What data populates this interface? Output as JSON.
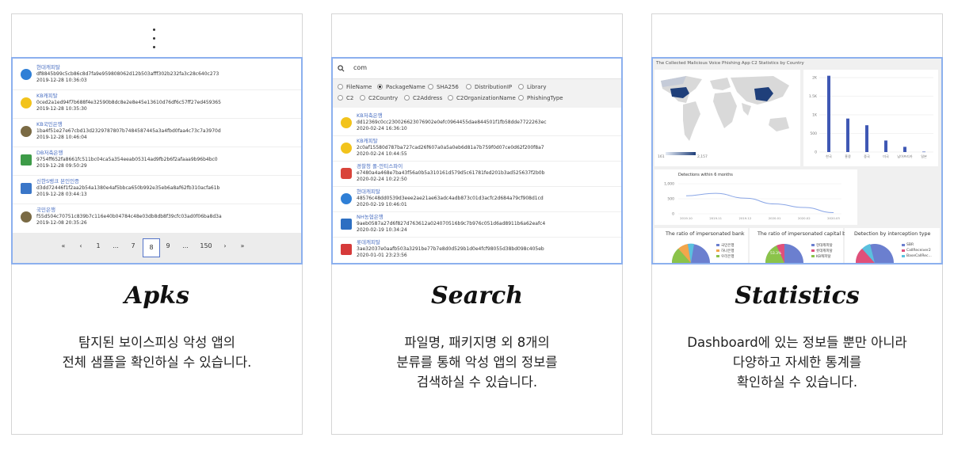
{
  "apks": {
    "title": "Apks",
    "desc": [
      "탐지된 보이스피싱 악성 앱의",
      "전체 샘플을 확인하실 수 있습니다."
    ],
    "rows": [
      {
        "name": "현대캐피탈",
        "hash": "df8845b99c5cb86c8d7fa9e959808062d12b503afff302b232fa3c28c640c273",
        "date": "2019-12-28 10:36:03",
        "icon_color": "#2f7fd6",
        "icon": "circle-logo-icon"
      },
      {
        "name": "KB캐피탈",
        "hash": "0ced2a1ed94f7b688f4e32590b8dc8e2e8e45e13610d76df6c57ff27ed459365",
        "date": "2019-12-28 10:35:30",
        "icon_color": "#f2c31c",
        "icon": "kb-logo-icon"
      },
      {
        "name": "KB국민은행",
        "hash": "1ba4f51e27e67cbd13d2329787807b7484587445a3a4fbd0faa4c73c7a3970d",
        "date": "2019-12-28 10:46:04",
        "icon_color": "#7a6a44",
        "icon": "kb-bank-logo-icon"
      },
      {
        "name": "DB저축은행",
        "hash": "9754ff652fa8661fc511bc04ca5a354eeab05314ad9fb2b6f2afaaa9b96b4bc0",
        "date": "2019-12-28 09:50:29",
        "icon_color": "#3d9b48",
        "icon": "db-logo-icon"
      },
      {
        "name": "신한S뱅크 본인인증",
        "hash": "d3dd72446f1f2aa2b54a1380e4af5bbca650b992e35eb6a8af62fb310acfa61b",
        "date": "2019-12-28 03:44:13",
        "icon_color": "#3a76c8",
        "icon": "shinhan-logo-icon"
      },
      {
        "name": "국민은행",
        "hash": "f55d504c70751c839b7c116e40b04784c48e03db8db8f39cfc03ad0f06ba8d3a",
        "date": "2019-12-08 20:35:26",
        "icon_color": "#7a6a44",
        "icon": "kb-bank-logo-icon"
      }
    ],
    "pager": [
      "«",
      "‹",
      "1",
      "...",
      "7",
      "8",
      "9",
      "...",
      "150",
      "›",
      "»"
    ],
    "pager_active": "8"
  },
  "search": {
    "title": "Search",
    "desc": [
      "파일명, 패키지명 외 8개의",
      "분류를 통해 악성 앱의 정보를",
      "검색하실 수 있습니다."
    ],
    "query": "com",
    "filters_row1": [
      "FileName",
      "PackageName",
      "SHA256",
      "DistributionIP",
      "Library"
    ],
    "filters_row2": [
      "C2",
      "C2Country",
      "C2Address",
      "C2OrganizationName",
      "PhishingType"
    ],
    "selected_filter": "PackageName",
    "rows": [
      {
        "name": "KB저축은행",
        "hash": "dd12369c0cc230026623076902e0efc0964455dae844501f1fb58dde7722263ec",
        "date": "2020-02-24 16:36:10",
        "icon_color": "#f2c31c"
      },
      {
        "name": "KB캐피탈",
        "hash": "2c0af15580d787ba727cad26f607a0a5a0eb6d81a7b759f0d07ce0d62f200f8a7",
        "date": "2020-02-24 10:44:55",
        "icon_color": "#f2c31c"
      },
      {
        "name": "경찰청 폴-안티스파이",
        "hash": "e7480a4a468e7ba43f56a0b5a310161d579d5c61781fed201b3ad525637f2b0b",
        "date": "2020-02-24 10:22:50",
        "icon_color": "#d9443a"
      },
      {
        "name": "현대캐피탈",
        "hash": "48576c48dd0539d3eee2ae21ae63adc4adb873c01d3acfc2d684a79cf908d1cd",
        "date": "2020-02-19 10:46:01",
        "icon_color": "#2f7fd6"
      },
      {
        "name": "NH농협은행",
        "hash": "9aeb0587a27d6f827d763612a024070516b9c7b976c051d6ad8911b6a62eafc4",
        "date": "2020-02-19 10:34:24",
        "icon_color": "#2d6fc2"
      },
      {
        "name": "롯데캐피탈",
        "hash": "3ae32037e0aafb503a3291be77b7e8d0d529b1d0e4fcf98055d38bd098c405eb",
        "date": "2020-01-01 23:23:56",
        "icon_color": "#d63a3a"
      }
    ]
  },
  "statistics": {
    "title": "Statistics",
    "desc": [
      "Dashboard에 있는 정보들 뿐만 아니라",
      "다양하고 자세한 통계를",
      "확인하실 수 있습니다."
    ],
    "dashboard_title": "The Collected Malicious Voice Phishing App C2 Statistics by Country",
    "map_scale": [
      "161",
      "2,157"
    ],
    "bar_yticks": [
      "2K",
      "1.5K",
      "1K",
      "500",
      "0"
    ],
    "bar_categories": [
      "한국",
      "홍콩",
      "중국",
      "미국",
      "남아프리카",
      "일본"
    ],
    "bar_values": [
      2050,
      900,
      720,
      310,
      140,
      10
    ],
    "line_title": "Detections within 6 months",
    "line_yticks": [
      "1,000",
      "500",
      "0"
    ],
    "line_xticks": [
      "2019.10",
      "2019.11",
      "2019.12",
      "2020.01",
      "2020.02",
      "2020.03"
    ],
    "line_values": [
      600,
      680,
      520,
      330,
      210,
      40
    ],
    "pie1_title": "The ratio of impersonated bank",
    "pie1_legend": [
      "국민은행",
      "하나은행",
      "우리은행"
    ],
    "pie2_title": "The ratio of impersonated capital bank",
    "pie2_legend": [
      "현대캐피탈",
      "롯데캐피탈",
      "KB캐피탈"
    ],
    "pie2_label": "53.3%",
    "pie3_title": "Detection by interception type",
    "pie3_legend": [
      "SBR",
      "CallReceiver2",
      "BaseCallRec..."
    ],
    "colors": {
      "bar": "#3f58b4",
      "map_dark": "#1f3f7a",
      "map_light": "#d9d9d9",
      "line": "#8aa6e6",
      "accent_border": "#8cb0ee"
    }
  }
}
